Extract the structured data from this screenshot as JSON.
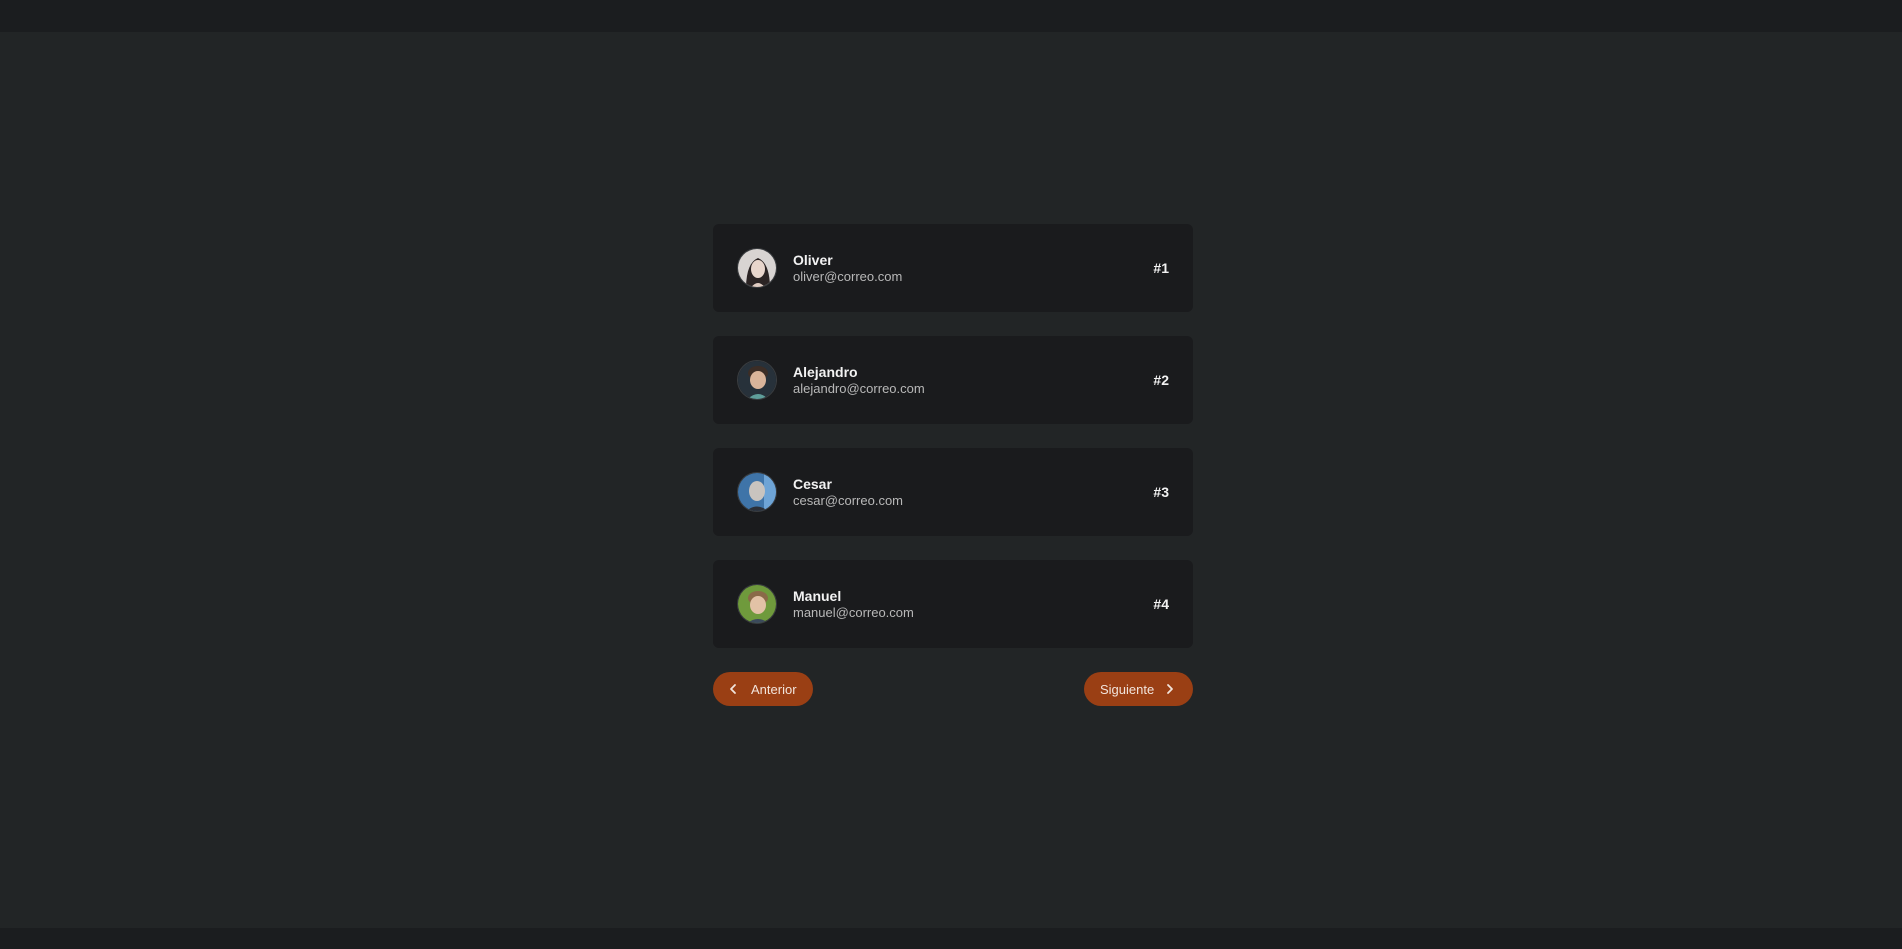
{
  "users": [
    {
      "name": "Oliver",
      "email": "oliver@correo.com",
      "rank": "#1"
    },
    {
      "name": "Alejandro",
      "email": "alejandro@correo.com",
      "rank": "#2"
    },
    {
      "name": "Cesar",
      "email": "cesar@correo.com",
      "rank": "#3"
    },
    {
      "name": "Manuel",
      "email": "manuel@correo.com",
      "rank": "#4"
    }
  ],
  "pagination": {
    "prev_label": "Anterior",
    "next_label": "Siguiente",
    "prev_icon": "chevron-left-icon",
    "next_icon": "chevron-right-icon"
  },
  "colors": {
    "background": "#222526",
    "card": "#1a1b1d",
    "accent": "#9a3f14"
  }
}
